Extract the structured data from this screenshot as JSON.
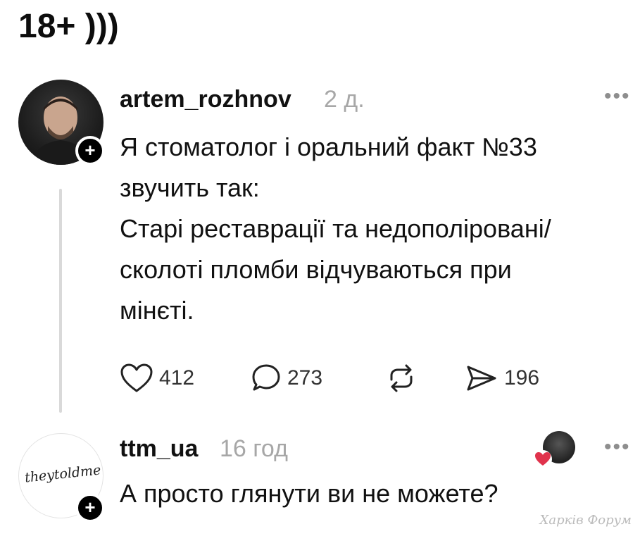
{
  "header": {
    "title": "18+ )))"
  },
  "post": {
    "username": "artem_rozhnov",
    "timestamp": "2 д.",
    "more_icon": "more-horizontal-icon",
    "lines": [
      "Я стоматолог і оральний факт №33",
      "звучить так:",
      "Старі реставрації та недополіровані/",
      "сколоті пломби відчуваються при",
      "мінєті."
    ],
    "actions": {
      "likes": "412",
      "comments": "273",
      "reposts": "",
      "shares": "196"
    }
  },
  "reply": {
    "username": "ttm_ua",
    "timestamp": "16 год",
    "avatar_signature": "theytoldme",
    "text": "А просто глянути ви не можете?",
    "liked_by_author": true,
    "heart_color": "#e0334c"
  },
  "watermark": "Харків Форум"
}
